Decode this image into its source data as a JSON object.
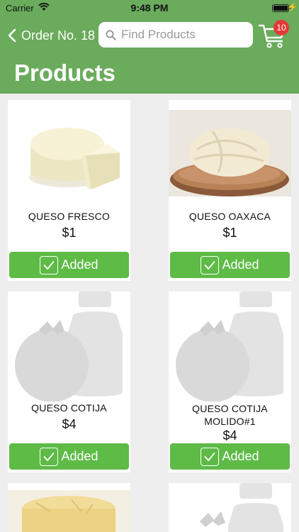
{
  "status_bar": {
    "carrier": "Carrier",
    "time": "9:48 PM"
  },
  "nav": {
    "back_label": "Order No. 18",
    "search_placeholder": "Find Products",
    "cart_count": "10"
  },
  "page_title": "Products",
  "products": [
    {
      "name": "QUESO FRESCO",
      "price": "$1",
      "button": "Added",
      "image": "queso-fresco-photo"
    },
    {
      "name": "QUESO OAXACA",
      "price": "$1",
      "button": "Added",
      "image": "queso-oaxaca-photo"
    },
    {
      "name": "QUESO COTIJA",
      "price": "$4",
      "button": "Added",
      "image": "placeholder-icon"
    },
    {
      "name": "QUESO COTIJA MOLIDO#1",
      "price": "$4",
      "button": "Added",
      "image": "placeholder-icon"
    },
    {
      "name": "",
      "price": "",
      "button": "",
      "image": "cheese-wheel-photo"
    },
    {
      "name": "",
      "price": "",
      "button": "",
      "image": "placeholder-icon"
    }
  ],
  "colors": {
    "header": "#6aab5c",
    "button": "#5dbb46",
    "badge": "#e53935"
  }
}
